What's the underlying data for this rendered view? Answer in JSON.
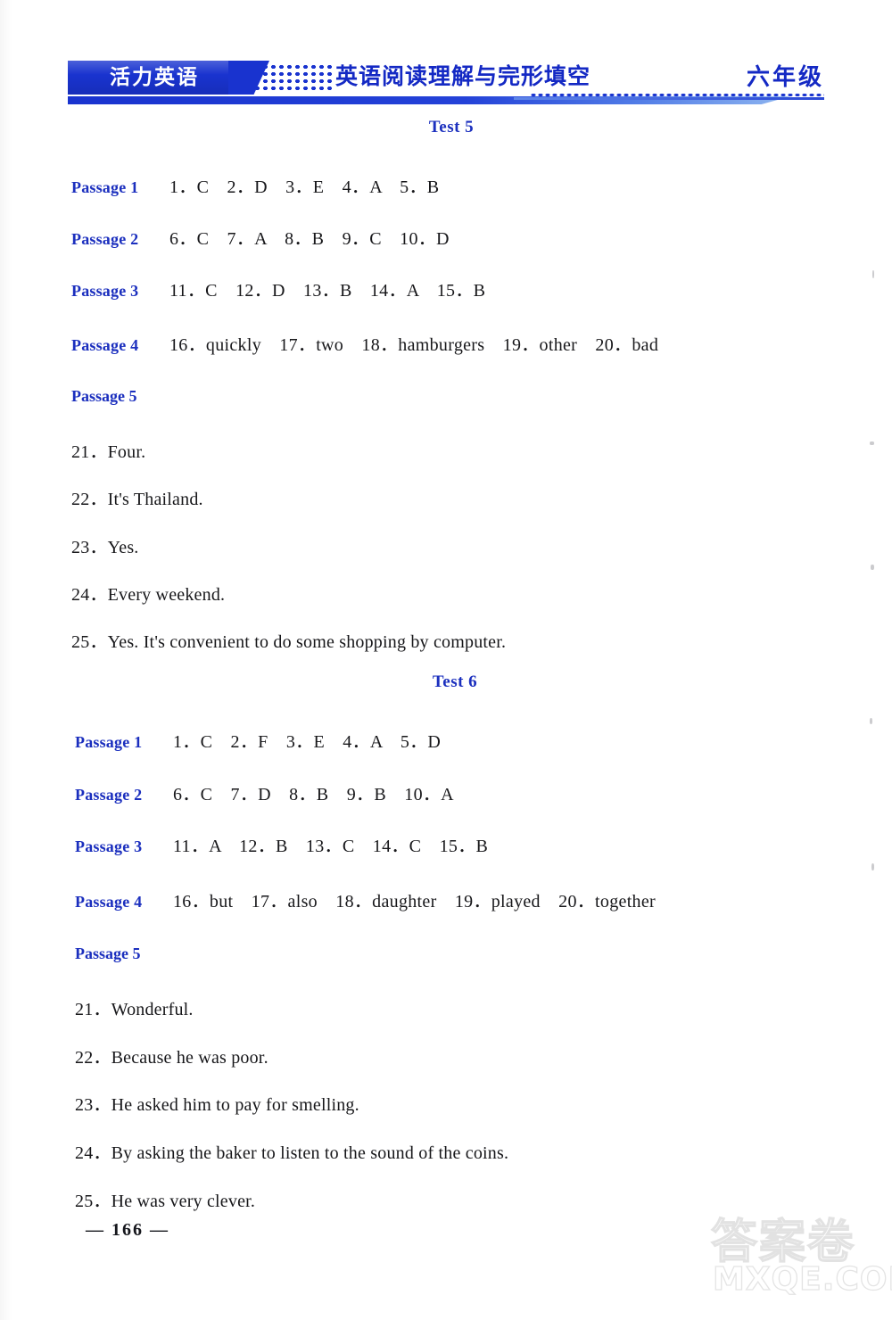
{
  "header": {
    "brand": "活力英语",
    "title": "英语阅读理解与完形填空",
    "grade": "六年级"
  },
  "tests": [
    {
      "heading": "Test 5",
      "passages": [
        {
          "label": "Passage 1",
          "answers": "1．C　2．D　3．E　4．A　5．B"
        },
        {
          "label": "Passage 2",
          "answers": "6．C　7．A　8．B　9．C　10．D"
        },
        {
          "label": "Passage 3",
          "answers": "11．C　12．D　13．B　14．A　15．B"
        },
        {
          "label": "Passage 4",
          "answers": "16．quickly　17．two　18．hamburgers　19．other　20．bad"
        }
      ],
      "passage5_label": "Passage 5",
      "passage5_answers": [
        "21．Four.",
        "22．It's Thailand.",
        "23．Yes.",
        "24．Every weekend.",
        "25．Yes.  It's convenient to do some shopping by computer."
      ]
    },
    {
      "heading": "Test 6",
      "passages": [
        {
          "label": "Passage 1",
          "answers": "1．C　2．F　3．E　4．A　5．D"
        },
        {
          "label": "Passage 2",
          "answers": "6．C　7．D　8．B　9．B　10．A"
        },
        {
          "label": "Passage 3",
          "answers": "11．A　12．B　13．C　14．C　15．B"
        },
        {
          "label": "Passage 4",
          "answers": "16．but　17．also　18．daughter　19．played　20．together"
        }
      ],
      "passage5_label": "Passage 5",
      "passage5_answers": [
        "21．Wonderful.",
        "22．Because he was poor.",
        "23．He asked him to pay for smelling.",
        "24．By asking the baker to listen to the sound of the coins.",
        "25．He was very clever."
      ]
    }
  ],
  "footer": {
    "page_number": "— 166 —"
  },
  "watermark": {
    "chinese": "答案卷",
    "site": "MXQE.COM"
  },
  "colors": {
    "brand_blue": "#1933cf",
    "heading_blue": "#1b2fbe",
    "body_black": "#17171a"
  }
}
